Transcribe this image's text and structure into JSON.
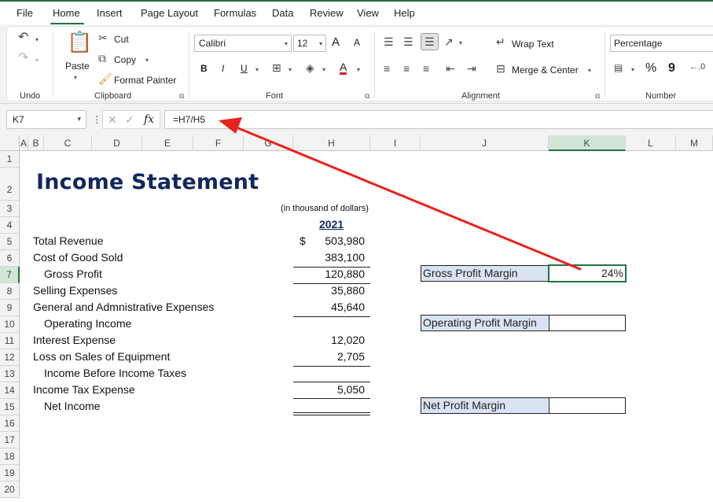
{
  "menu": [
    "File",
    "Home",
    "Insert",
    "Page Layout",
    "Formulas",
    "Data",
    "Review",
    "View",
    "Help"
  ],
  "ribbon": {
    "undo_group": "Undo",
    "clipboard": {
      "paste": "Paste",
      "cut": "Cut",
      "copy": "Copy",
      "format_painter": "Format Painter",
      "label": "Clipboard"
    },
    "font": {
      "family": "Calibri",
      "size": "12",
      "bold": "B",
      "italic": "I",
      "underline": "U",
      "grow": "A",
      "shrink": "A",
      "color_a": "A",
      "label": "Font"
    },
    "alignment": {
      "wrap": "Wrap Text",
      "merge": "Merge & Center",
      "label": "Alignment"
    },
    "number": {
      "format": "Percentage",
      "percent": "%",
      "comma": "9",
      "label": "Number"
    }
  },
  "formula_bar": {
    "name_box": "K7",
    "fx": "fx",
    "formula": "=H7/H5"
  },
  "columns": [
    "A",
    "B",
    "C",
    "D",
    "E",
    "F",
    "G",
    "H",
    "I",
    "J",
    "K",
    "L",
    "M"
  ],
  "rows": [
    "1",
    "2",
    "3",
    "4",
    "5",
    "6",
    "7",
    "8",
    "9",
    "10",
    "11",
    "12",
    "13",
    "14",
    "15",
    "16",
    "17",
    "18",
    "19",
    "20"
  ],
  "sheet": {
    "title": "Income Statement",
    "units_note": "(in thousand of dollars)",
    "year": "2021",
    "currency_symbol": "$",
    "lines": [
      {
        "label": "Total Revenue",
        "value": "503,980"
      },
      {
        "label": "Cost of Good Sold",
        "value": "383,100"
      },
      {
        "label": "Gross Profit",
        "value": "120,880"
      },
      {
        "label": "Selling Expenses",
        "value": "35,880"
      },
      {
        "label": "General and Admnistrative Expenses",
        "value": "45,640"
      },
      {
        "label": "Operating Income",
        "value": ""
      },
      {
        "label": "Interest Expense",
        "value": "12,020"
      },
      {
        "label": "Loss on Sales of Equipment",
        "value": "2,705"
      },
      {
        "label": "Income Before Income Taxes",
        "value": ""
      },
      {
        "label": "Income Tax Expense",
        "value": "5,050"
      },
      {
        "label": "Net Income",
        "value": ""
      }
    ],
    "ratios": [
      {
        "label": "Gross Profit Margin",
        "value": "24%"
      },
      {
        "label": "Operating Profit Margin",
        "value": ""
      },
      {
        "label": "Net Profit Margin",
        "value": ""
      }
    ]
  },
  "colors": {
    "accent": "#217346",
    "title": "#12275e",
    "label_fill": "#dae3f3",
    "arrow": "#e8231e"
  }
}
